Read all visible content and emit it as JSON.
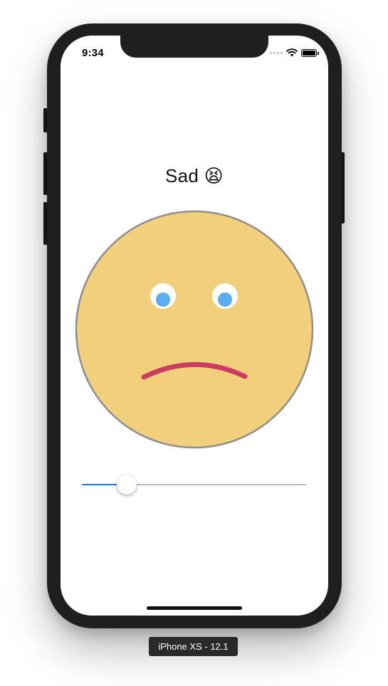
{
  "status_bar": {
    "time": "9:34"
  },
  "mood": {
    "label": "Sad",
    "emoji": "😫"
  },
  "face": {
    "fill": "#f2cf7b",
    "stroke": "#8e8e8e",
    "mouth_color": "#cc3b61",
    "pupil_color": "#5aaef4"
  },
  "slider": {
    "value": 0.2,
    "fill_color": "#1e74e3"
  },
  "simulator": {
    "device_label": "iPhone XS - 12.1"
  }
}
